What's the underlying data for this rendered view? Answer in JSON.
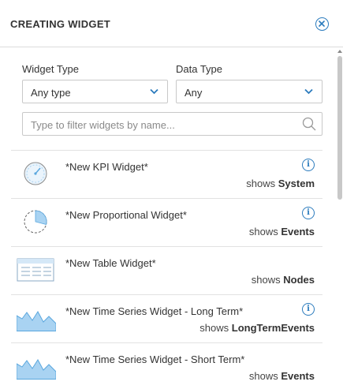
{
  "header": {
    "title": "CREATING WIDGET"
  },
  "filters": {
    "widget_type_label": "Widget Type",
    "widget_type_value": "Any type",
    "data_type_label": "Data Type",
    "data_type_value": "Any",
    "search_placeholder": "Type to filter widgets by name..."
  },
  "shows_prefix": "shows",
  "widgets": [
    {
      "name": "*New KPI Widget*",
      "shows": "System",
      "icon": "kpi-gauge-icon",
      "info": true
    },
    {
      "name": "*New Proportional Widget*",
      "shows": "Events",
      "icon": "pie-chart-icon",
      "info": true
    },
    {
      "name": "*New Table Widget*",
      "shows": "Nodes",
      "icon": "table-icon",
      "info": false
    },
    {
      "name": "*New Time Series Widget - Long Term*",
      "shows": "LongTermEvents",
      "icon": "area-chart-icon",
      "info": true
    },
    {
      "name": "*New Time Series Widget - Short Term*",
      "shows": "Events",
      "icon": "area-chart-icon",
      "info": false
    }
  ],
  "colors": {
    "accent": "#2b7bbd",
    "chart_fill": "#a9d3f2",
    "chart_stroke": "#5aa7de"
  }
}
